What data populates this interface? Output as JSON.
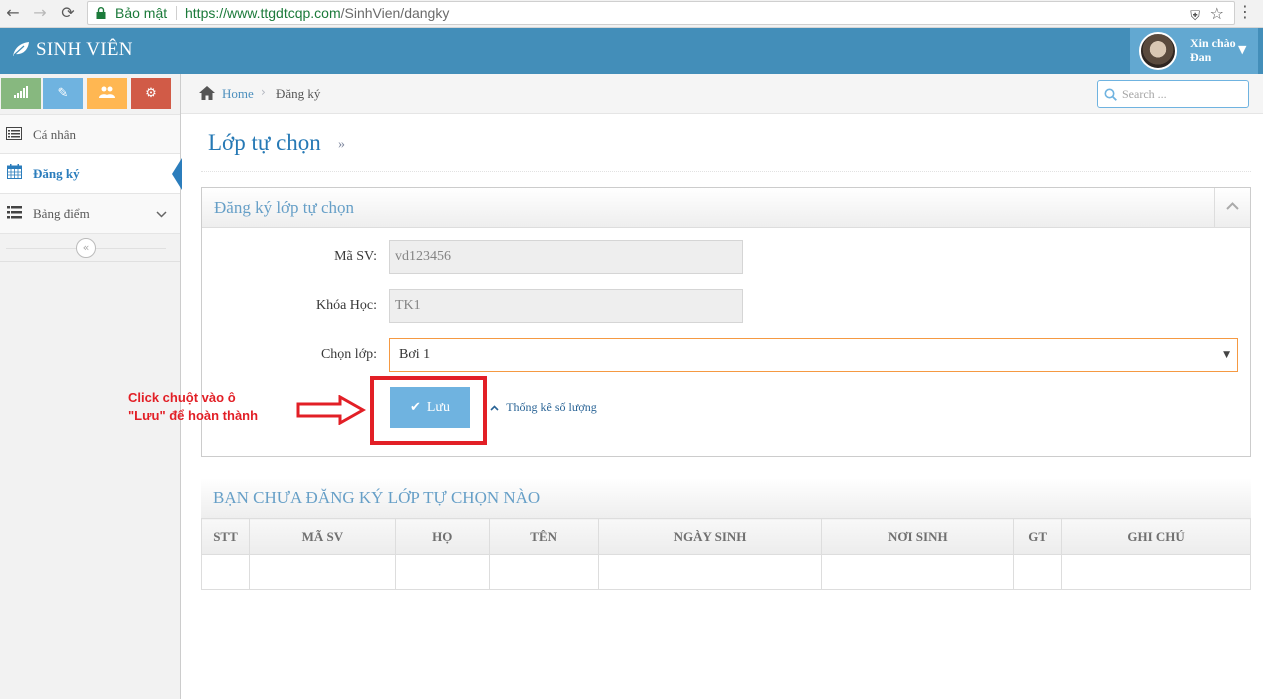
{
  "browser": {
    "secure_label": "Bảo mật",
    "url_host": "https://www.ttgdtcqp.com",
    "url_path": "/SinhVien/dangky"
  },
  "header": {
    "brand": "SINH VIÊN",
    "greeting": "Xin chào",
    "user_name": "Đan"
  },
  "colors": {
    "header": "#438eb9",
    "user_box": "#62a8d1",
    "shortcut_green": "#87b87f",
    "shortcut_blue": "#6fb3e0",
    "shortcut_orange": "#ffb752",
    "shortcut_red": "#d15b47",
    "annotation_red": "#e21f26",
    "save_button": "#6fb3e0"
  },
  "sidebar": {
    "shortcuts": [
      "signal-icon",
      "pencil-icon",
      "users-icon",
      "cogs-icon"
    ],
    "items": [
      {
        "label": "Cá nhân",
        "icon": "list-alt-icon"
      },
      {
        "label": "Đăng ký",
        "icon": "calendar-icon",
        "active": true
      },
      {
        "label": "Bảng điểm",
        "icon": "list-icon"
      }
    ]
  },
  "breadcrumb": {
    "home": "Home",
    "current": "Đăng ký"
  },
  "search": {
    "placeholder": "Search ..."
  },
  "page": {
    "title": "Lớp tự chọn",
    "title_suffix": "»"
  },
  "form": {
    "panel_title": "Đăng ký lớp tự chọn",
    "student_id_label": "Mã SV:",
    "student_id_value": "vd123456",
    "course_label": "Khóa Học:",
    "course_value": "TK1",
    "class_label": "Chọn lớp:",
    "class_value": "Bơi 1",
    "save_label": "Lưu",
    "stats_link": "Thống kê số lượng"
  },
  "annotation": {
    "line1": "Click chuột vào ô",
    "line2": "\"Lưu\" để hoàn thành"
  },
  "table": {
    "caption": "BẠN CHƯA ĐĂNG KÝ LỚP TỰ CHỌN NÀO",
    "columns": [
      "STT",
      "MÃ SV",
      "HỌ",
      "TÊN",
      "NGÀY SINH",
      "NƠI SINH",
      "GT",
      "GHI CHÚ"
    ],
    "rows": []
  }
}
